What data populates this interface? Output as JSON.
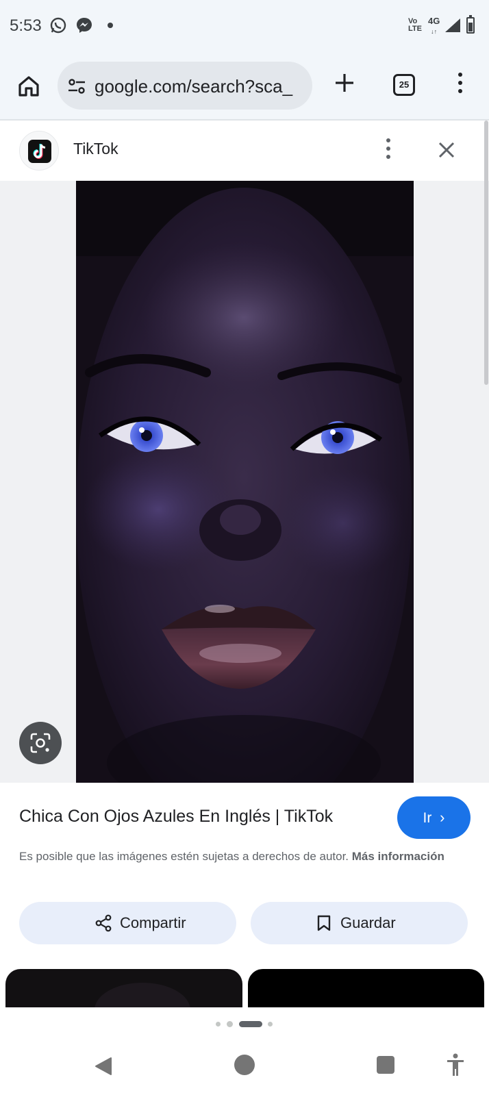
{
  "status_bar": {
    "time": "5:53",
    "app_icons": [
      "whatsapp-icon",
      "messenger-icon"
    ],
    "volte": "Vo\nLTE",
    "network": "4G"
  },
  "browser": {
    "url": "google.com/search?sca_",
    "tab_count": "25"
  },
  "source": {
    "name": "TikTok"
  },
  "result": {
    "title": "Chica Con Ojos Azules En Inglés | TikTok",
    "go_label": "Ir",
    "go_chevron": "›",
    "copyright_text": "Es posible que las imágenes estén sujetas a derechos de autor. ",
    "more_info": "Más información"
  },
  "actions": {
    "share_label": "Compartir",
    "save_label": "Guardar"
  },
  "pager": {
    "total": 4,
    "active_index": 2
  },
  "colors": {
    "accent": "#1a73e8",
    "chip_bg": "#e8eefa",
    "toolbar_bg": "#f2f6fa"
  }
}
